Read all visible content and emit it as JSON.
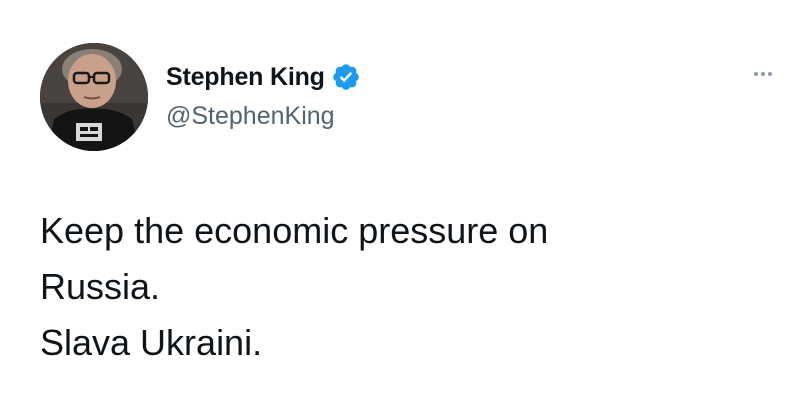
{
  "author": {
    "display_name": "Stephen King",
    "handle": "@StephenKing",
    "verified": true,
    "avatar_icon": "profile-photo",
    "verified_icon": "verified-badge-icon"
  },
  "menu": {
    "icon": "more-options-icon"
  },
  "tweet": {
    "lines": [
      "Keep the economic pressure on",
      "Russia.",
      "Slava Ukraini."
    ]
  },
  "colors": {
    "verified_blue": "#1d9bf0",
    "text_primary": "#0f1419",
    "text_secondary": "#536471",
    "more_dots": "#8b98a5"
  }
}
